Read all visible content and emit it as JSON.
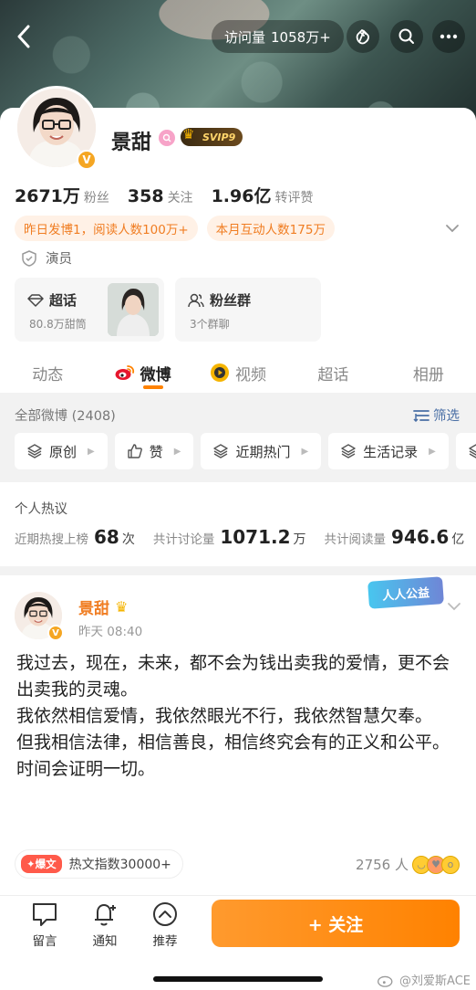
{
  "header": {
    "visits_label": "访问量",
    "visits_value": "1058万+"
  },
  "profile": {
    "name": "景甜",
    "v_badge": "V",
    "svip_label": "SVIP9",
    "occupation": "演员",
    "stats": [
      {
        "num": "2671万",
        "label": "粉丝"
      },
      {
        "num": "358",
        "label": "关注"
      },
      {
        "num": "1.96亿",
        "label": "转评赞"
      }
    ],
    "chips": [
      "昨日发博1，阅读人数100万+",
      "本月互动人数175万"
    ],
    "supertopic": {
      "title": "超话",
      "sub": "80.8万甜筒"
    },
    "fangroup": {
      "title": "粉丝群",
      "sub": "3个群聊"
    }
  },
  "tabs": [
    {
      "label": "动态",
      "active": false
    },
    {
      "label": "微博",
      "active": true
    },
    {
      "label": "视频",
      "active": false
    },
    {
      "label": "超话",
      "active": false
    },
    {
      "label": "相册",
      "active": false
    }
  ],
  "filter": {
    "all_label": "全部微博 (2408)",
    "filter_link": "筛选",
    "chips": [
      "原创",
      "赞",
      "近期热门",
      "生活记录"
    ]
  },
  "hot": {
    "title": "个人热议",
    "items": [
      {
        "label": "近期热搜上榜",
        "num": "68",
        "unit": "次"
      },
      {
        "label": "共计讨论量",
        "num": "1071.2",
        "unit": "万"
      },
      {
        "label": "共计阅读量",
        "num": "946.6",
        "unit": "亿"
      }
    ]
  },
  "post": {
    "name": "景甜",
    "time": "昨天 08:40",
    "badge": "人人公益",
    "lines": [
      "我过去，现在，未来，都不会为钱出卖我的爱情，更不会出卖我的灵魂。",
      "我依然相信爱情，我依然眼光不行，我依然智慧欠奉。",
      "但我相信法律，相信善良，相信终究会有的正义和公平。",
      "时间会证明一切。"
    ],
    "hot_tag": "爆文",
    "hot_index": "热文指数30000+",
    "react_count": "2756 人"
  },
  "bottom": {
    "comment": "留言",
    "notify": "通知",
    "recommend": "推荐",
    "follow": "+ 关注"
  },
  "watermark": "@刘爱斯ACE",
  "colors": {
    "accent": "#ff8200",
    "link": "#4a6fa5",
    "chip_text": "#f07d22"
  }
}
